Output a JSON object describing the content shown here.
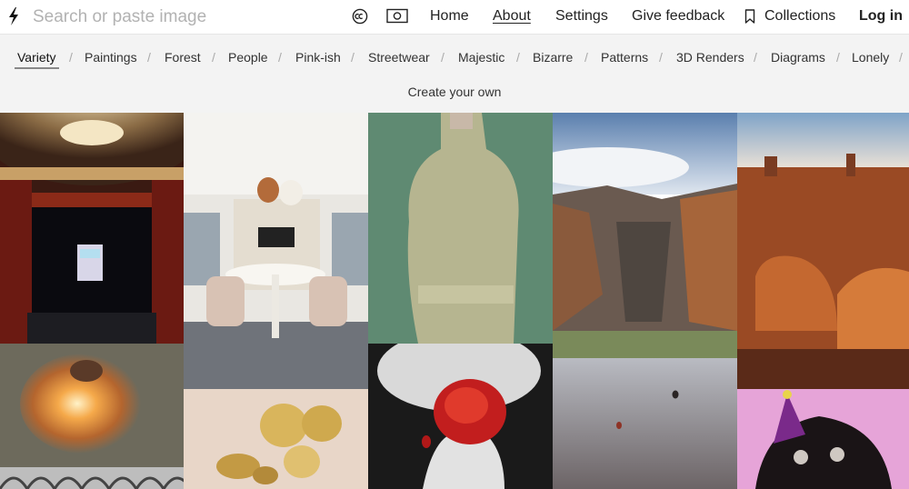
{
  "header": {
    "search": {
      "placeholder": "Search or paste image",
      "value": ""
    },
    "icons": [
      "bolt-logo-icon",
      "creative-commons-icon",
      "photo-camera-icon",
      "bookmark-icon"
    ],
    "nav": {
      "home": "Home",
      "about": "About",
      "settings": "Settings",
      "feedback": "Give feedback",
      "collections": "Collections",
      "login": "Log in"
    }
  },
  "categories": {
    "items": [
      "Variety",
      "Paintings",
      "Forest",
      "People",
      "Pink-ish",
      "Streetwear",
      "Majestic",
      "Bizarre",
      "Patterns",
      "3D Renders",
      "Diagrams",
      "Lonely"
    ],
    "separator": "/",
    "active": "Variety",
    "create_own": "Create your own"
  },
  "grid": {
    "images": [
      "theater-stage-ice-cream-truck",
      "explosion-aerial",
      "ornate-pattern",
      "meeting-room-pendant-lamps",
      "gold-disc-wall-sculpture",
      "mannequin-green-knit",
      "hand-holding-red-rose",
      "canyon-landscape",
      "hot-air-balloons-dusk",
      "red-rock-desert",
      "party-hat-monkey-illustration"
    ]
  },
  "colors": {
    "topbar_bg": "#ffffff",
    "catbar_bg": "#f3f3f3",
    "text": "#222222",
    "placeholder": "#b2b2b2",
    "separator": "#aaaaaa"
  }
}
